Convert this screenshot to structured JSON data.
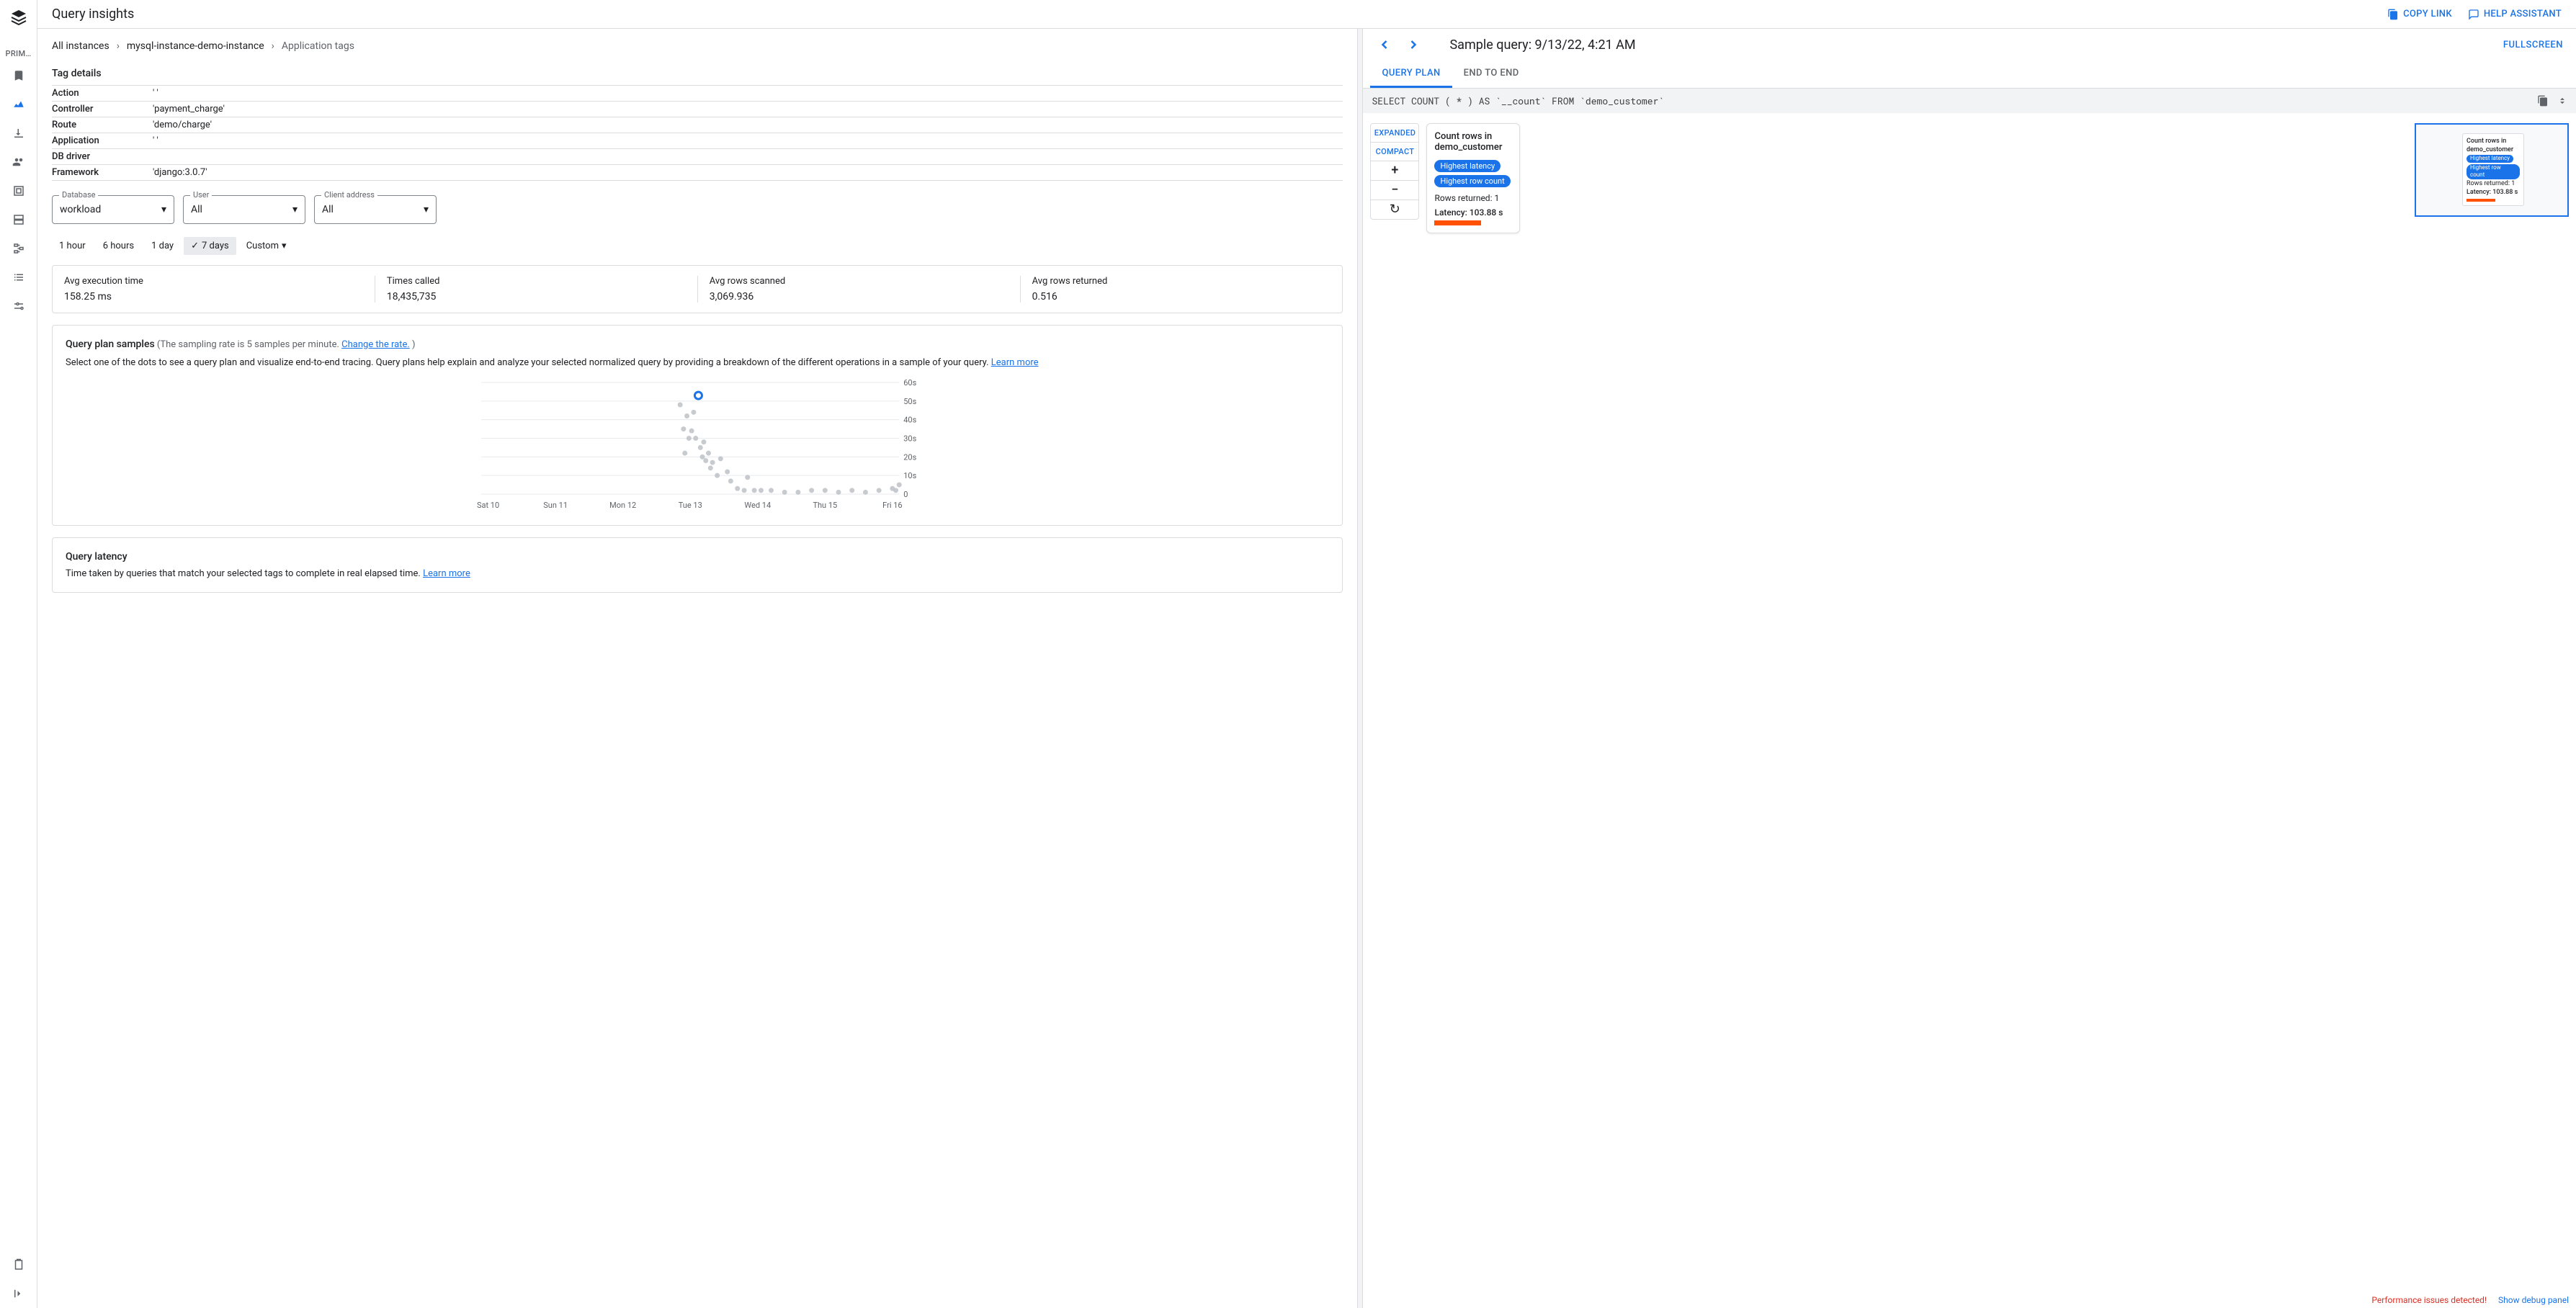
{
  "sidenav": {
    "section_label": "PRIM…"
  },
  "header": {
    "title": "Query insights",
    "copy_link": "COPY LINK",
    "help_assistant": "HELP ASSISTANT"
  },
  "breadcrumbs": {
    "all_instances": "All instances",
    "instance": "mysql-instance-demo-instance",
    "current": "Application tags"
  },
  "tag_details": {
    "title": "Tag details",
    "rows": {
      "action_k": "Action",
      "action_v": "' '",
      "controller_k": "Controller",
      "controller_v": "'payment_charge'",
      "route_k": "Route",
      "route_v": "'demo/charge'",
      "application_k": "Application",
      "application_v": "' '",
      "dbdriver_k": "DB driver",
      "dbdriver_v": "",
      "framework_k": "Framework",
      "framework_v": "'django:3.0.7'"
    }
  },
  "filters": {
    "database_label": "Database",
    "database_value": "workload",
    "user_label": "User",
    "user_value": "All",
    "client_label": "Client address",
    "client_value": "All"
  },
  "time_range": {
    "h1": "1 hour",
    "h6": "6 hours",
    "d1": "1 day",
    "d7": "7 days",
    "custom": "Custom"
  },
  "stats": {
    "exec_label": "Avg execution time",
    "exec_value": "158.25 ms",
    "times_label": "Times called",
    "times_value": "18,435,735",
    "rows_scanned_label": "Avg rows scanned",
    "rows_scanned_value": "3,069.936",
    "rows_returned_label": "Avg rows returned",
    "rows_returned_value": "0.516"
  },
  "samples": {
    "title": "Query plan samples",
    "subtitle_prefix": "(The sampling rate is 5 samples per minute. ",
    "change_rate": "Change the rate.",
    "subtitle_suffix": " )",
    "desc_prefix": "Select one of the dots to see a query plan and visualize end-to-end tracing. Query plans help explain and analyze your selected normalized query by providing a breakdown of the different operations in a sample of your query. ",
    "learn_more": "Learn more"
  },
  "chart_data": {
    "type": "scatter",
    "x_categories": [
      "Sat 10",
      "Sun 11",
      "Mon 12",
      "Tue 13",
      "Wed 14",
      "Thu 15",
      "Fri 16"
    ],
    "ylabel_ticks": [
      "0",
      "10s",
      "20s",
      "30s",
      "40s",
      "50s",
      "60s"
    ],
    "ylim": [
      0,
      60
    ],
    "selected": {
      "day_index": 3,
      "x_offset": 0.12,
      "y": 53
    },
    "points": [
      {
        "day_index": 2,
        "x_offset": 0.85,
        "y": 48
      },
      {
        "day_index": 2,
        "x_offset": 0.9,
        "y": 35
      },
      {
        "day_index": 2,
        "x_offset": 0.92,
        "y": 22
      },
      {
        "day_index": 2,
        "x_offset": 0.95,
        "y": 42
      },
      {
        "day_index": 2,
        "x_offset": 0.98,
        "y": 30
      },
      {
        "day_index": 3,
        "x_offset": 0.02,
        "y": 34
      },
      {
        "day_index": 3,
        "x_offset": 0.05,
        "y": 44
      },
      {
        "day_index": 3,
        "x_offset": 0.08,
        "y": 30
      },
      {
        "day_index": 3,
        "x_offset": 0.12,
        "y": 53
      },
      {
        "day_index": 3,
        "x_offset": 0.15,
        "y": 25
      },
      {
        "day_index": 3,
        "x_offset": 0.18,
        "y": 20
      },
      {
        "day_index": 3,
        "x_offset": 0.2,
        "y": 28
      },
      {
        "day_index": 3,
        "x_offset": 0.23,
        "y": 18
      },
      {
        "day_index": 3,
        "x_offset": 0.27,
        "y": 22
      },
      {
        "day_index": 3,
        "x_offset": 0.3,
        "y": 14
      },
      {
        "day_index": 3,
        "x_offset": 0.33,
        "y": 17
      },
      {
        "day_index": 3,
        "x_offset": 0.4,
        "y": 10
      },
      {
        "day_index": 3,
        "x_offset": 0.45,
        "y": 19
      },
      {
        "day_index": 3,
        "x_offset": 0.55,
        "y": 12
      },
      {
        "day_index": 3,
        "x_offset": 0.6,
        "y": 7
      },
      {
        "day_index": 3,
        "x_offset": 0.7,
        "y": 3
      },
      {
        "day_index": 3,
        "x_offset": 0.8,
        "y": 2
      },
      {
        "day_index": 3,
        "x_offset": 0.85,
        "y": 9
      },
      {
        "day_index": 3,
        "x_offset": 0.95,
        "y": 2
      },
      {
        "day_index": 4,
        "x_offset": 0.05,
        "y": 2
      },
      {
        "day_index": 4,
        "x_offset": 0.2,
        "y": 2
      },
      {
        "day_index": 4,
        "x_offset": 0.4,
        "y": 1
      },
      {
        "day_index": 4,
        "x_offset": 0.6,
        "y": 1
      },
      {
        "day_index": 4,
        "x_offset": 0.8,
        "y": 2
      },
      {
        "day_index": 5,
        "x_offset": 0.0,
        "y": 2
      },
      {
        "day_index": 5,
        "x_offset": 0.2,
        "y": 1
      },
      {
        "day_index": 5,
        "x_offset": 0.4,
        "y": 2
      },
      {
        "day_index": 5,
        "x_offset": 0.6,
        "y": 1
      },
      {
        "day_index": 5,
        "x_offset": 0.8,
        "y": 2
      },
      {
        "day_index": 6,
        "x_offset": 0.0,
        "y": 3
      },
      {
        "day_index": 6,
        "x_offset": 0.05,
        "y": 2
      },
      {
        "day_index": 6,
        "x_offset": 0.1,
        "y": 5
      }
    ]
  },
  "latency_card": {
    "title": "Query latency",
    "desc_prefix": "Time taken by queries that match your selected tags to complete in real elapsed time. ",
    "learn_more": "Learn more"
  },
  "right": {
    "title_prefix": "Sample query: ",
    "title_time": "9/13/22, 4:21 AM",
    "fullscreen": "FULLSCREEN",
    "tabs": {
      "query_plan": "QUERY PLAN",
      "end_to_end": "END TO END"
    },
    "query": "SELECT COUNT ( * ) AS `__count` FROM `demo_customer`",
    "toolbar": {
      "expanded": "EXPANDED",
      "compact": "COMPACT"
    },
    "node": {
      "title": "Count rows in demo_customer",
      "badge1": "Highest latency",
      "badge2": "Highest row count",
      "rows_returned": "Rows returned: 1",
      "latency": "Latency: 103.88 s"
    },
    "minimap": {
      "title": "Count rows in demo_customer",
      "badge1": "Highest latency",
      "badge2": "Highest row count",
      "rows_returned": "Rows returned: 1",
      "latency": "Latency: 103.88 s"
    }
  },
  "footer": {
    "error": "Performance issues detected!",
    "debug": "Show debug panel"
  }
}
